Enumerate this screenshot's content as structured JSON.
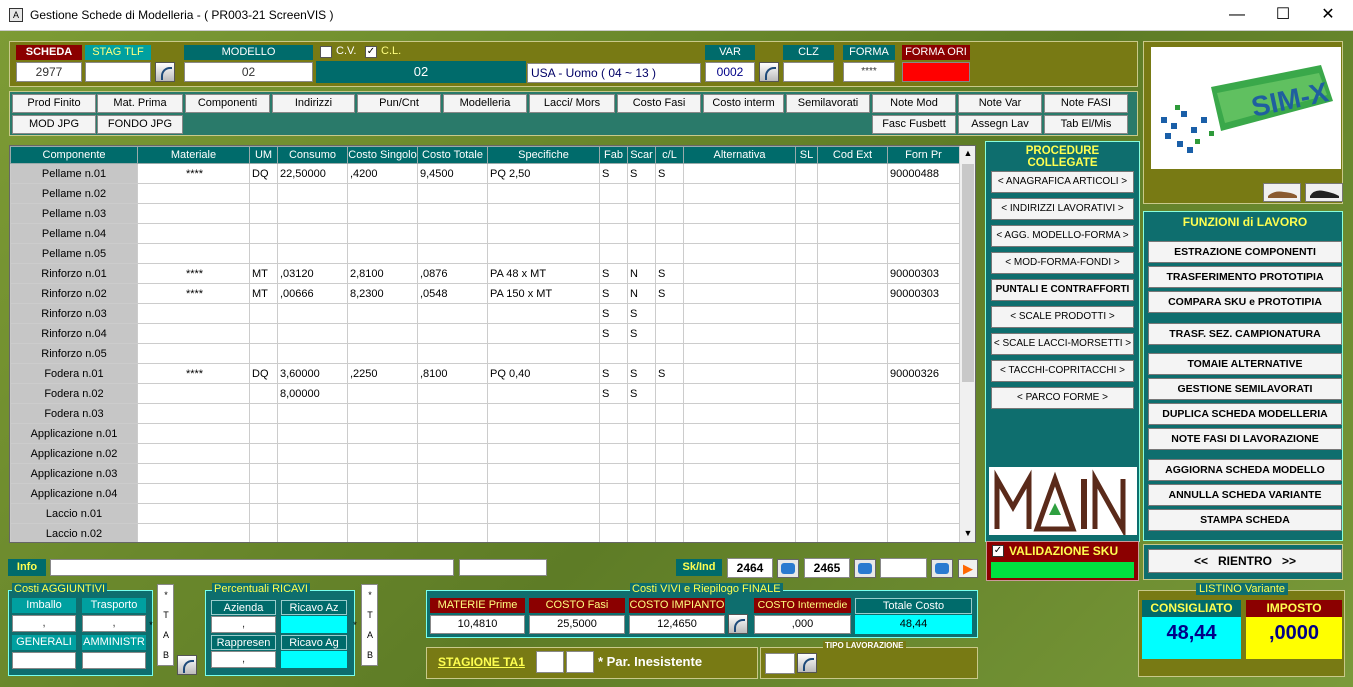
{
  "window": {
    "title": "Gestione Schede di Modelleria - ( PR003-21 ScreenVIS )",
    "app_icon": "A"
  },
  "header": {
    "scheda_label": "SCHEDA",
    "scheda_value": "2977",
    "stag_label": "STAG TLF",
    "stag_value": "",
    "modello_label": "MODELLO",
    "modello_value": "02",
    "cv_label": "C.V.",
    "cl_label": "C.L.",
    "cv_checked": false,
    "cl_checked": true,
    "modello_display": "02",
    "forma_desc": "USA - Uomo ( 04 ~ 13 )",
    "var_label": "VAR",
    "var_value": "0002",
    "clz_label": "CLZ",
    "clz_value": "",
    "forma_label": "FORMA",
    "forma_value": "****",
    "forma_ori_label": "FORMA ORI",
    "forma_ori_value": ""
  },
  "tabs_row1": [
    "Prod Finito",
    "Mat. Prima",
    "Componenti",
    "Indirizzi",
    "Pun/Cnt",
    "Modelleria",
    "Lacci/ Mors",
    "Costo Fasi",
    "Costo interm",
    "Semilavorati",
    "Note Mod",
    "Note Var",
    "Note FASI"
  ],
  "tabs_row2_left": [
    "MOD JPG",
    "FONDO JPG"
  ],
  "tabs_row2_right": [
    "Fasc Fusbett",
    "Assegn Lav",
    "Tab El/Mis"
  ],
  "grid": {
    "columns": [
      "Componente",
      "Materiale",
      "UM",
      "Consumo",
      "Costo Singolo",
      "Costo Totale",
      "Specifiche",
      "Fab",
      "Scar",
      "c/L",
      "Alternativa",
      "SL",
      "Cod Ext",
      "Forn Pr"
    ],
    "rows": [
      [
        "Pellame n.01",
        "****",
        "DQ",
        "22,50000",
        ",4200",
        "9,4500",
        "PQ 2,50",
        "S",
        "S",
        "S",
        "",
        "",
        "",
        "90000488"
      ],
      [
        "Pellame n.02",
        "",
        "",
        "",
        "",
        "",
        "",
        "",
        "",
        "",
        "",
        "",
        "",
        ""
      ],
      [
        "Pellame n.03",
        "",
        "",
        "",
        "",
        "",
        "",
        "",
        "",
        "",
        "",
        "",
        "",
        ""
      ],
      [
        "Pellame n.04",
        "",
        "",
        "",
        "",
        "",
        "",
        "",
        "",
        "",
        "",
        "",
        "",
        ""
      ],
      [
        "Pellame n.05",
        "",
        "",
        "",
        "",
        "",
        "",
        "",
        "",
        "",
        "",
        "",
        "",
        ""
      ],
      [
        "Rinforzo n.01",
        "****",
        "MT",
        ",03120",
        "2,8100",
        ",0876",
        "PA 48 x MT",
        "S",
        "N",
        "S",
        "",
        "",
        "",
        "90000303"
      ],
      [
        "Rinforzo n.02",
        "****",
        "MT",
        ",00666",
        "8,2300",
        ",0548",
        "PA 150 x MT",
        "S",
        "N",
        "S",
        "",
        "",
        "",
        "90000303"
      ],
      [
        "Rinforzo n.03",
        "",
        "",
        "",
        "",
        "",
        "",
        "S",
        "S",
        "",
        "",
        "",
        "",
        ""
      ],
      [
        "Rinforzo n.04",
        "",
        "",
        "",
        "",
        "",
        "",
        "S",
        "S",
        "",
        "",
        "",
        "",
        ""
      ],
      [
        "Rinforzo n.05",
        "",
        "",
        "",
        "",
        "",
        "",
        "",
        "",
        "",
        "",
        "",
        "",
        ""
      ],
      [
        "Fodera n.01",
        "****",
        "DQ",
        "3,60000",
        ",2250",
        ",8100",
        "PQ 0,40",
        "S",
        "S",
        "S",
        "",
        "",
        "",
        "90000326"
      ],
      [
        "Fodera n.02",
        "",
        "",
        "8,00000",
        "",
        "",
        "",
        "S",
        "S",
        "",
        "",
        "",
        "",
        ""
      ],
      [
        "Fodera n.03",
        "",
        "",
        "",
        "",
        "",
        "",
        "",
        "",
        "",
        "",
        "",
        "",
        ""
      ],
      [
        "Applicazione n.01",
        "",
        "",
        "",
        "",
        "",
        "",
        "",
        "",
        "",
        "",
        "",
        "",
        ""
      ],
      [
        "Applicazione n.02",
        "",
        "",
        "",
        "",
        "",
        "",
        "",
        "",
        "",
        "",
        "",
        "",
        ""
      ],
      [
        "Applicazione n.03",
        "",
        "",
        "",
        "",
        "",
        "",
        "",
        "",
        "",
        "",
        "",
        "",
        ""
      ],
      [
        "Applicazione n.04",
        "",
        "",
        "",
        "",
        "",
        "",
        "",
        "",
        "",
        "",
        "",
        "",
        ""
      ],
      [
        "Laccio n.01",
        "",
        "",
        "",
        "",
        "",
        "",
        "",
        "",
        "",
        "",
        "",
        "",
        ""
      ],
      [
        "Laccio n.02",
        "",
        "",
        "",
        "",
        "",
        "",
        "",
        "",
        "",
        "",
        "",
        "",
        ""
      ]
    ]
  },
  "procedure": {
    "title": "PROCEDURE COLLEGATE",
    "items": [
      "< ANAGRAFICA ARTICOLI >",
      "< INDIRIZZI LAVORATIVI >",
      "< AGG. MODELLO-FORMA >",
      "< MOD-FORMA-FONDI >",
      "PUNTALI E CONTRAFFORTI",
      "< SCALE PRODOTTI >",
      "< SCALE LACCI-MORSETTI >",
      "< TACCHI-COPRITACCHI >",
      "< PARCO FORME >"
    ]
  },
  "logo": {
    "brand": "SIM-X",
    "main_logo": "MAIN"
  },
  "funzioni": {
    "title": "FUNZIONI di LAVORO",
    "group1": [
      "ESTRAZIONE COMPONENTI",
      "TRASFERIMENTO PROTOTIPIA",
      "COMPARA SKU e PROTOTIPIA"
    ],
    "group2": [
      "TRASF. SEZ. CAMPIONATURA"
    ],
    "group3": [
      "TOMAIE ALTERNATIVE",
      "GESTIONE SEMILAVORATI",
      "DUPLICA SCHEDA MODELLERIA",
      "NOTE FASI DI LAVORAZIONE"
    ],
    "group4": [
      "AGGIORNA SCHEDA MODELLO",
      "ANNULLA SCHEDA VARIANTE",
      "STAMPA SCHEDA"
    ],
    "rientro": "<<   RIENTRO   >>"
  },
  "validazione": {
    "label": "VALIDAZIONE SKU",
    "checked": true
  },
  "info": {
    "label": "Info",
    "value": ""
  },
  "skind": {
    "label": "Sk/Ind",
    "a": "2464",
    "b": "2465",
    "c": ""
  },
  "costi_aggiuntivi": {
    "title": "Costi AGGIUNTIVI",
    "imballo": "Imballo",
    "trasporto": "Trasporto",
    "imballo_value": ",",
    "trasporto_value": ",",
    "generali": "GENERALI",
    "amministr": "AMMINISTR",
    "tab": "* T A B *"
  },
  "percentuali": {
    "title": "Percentuali RICAVI",
    "azienda": "Azienda",
    "azienda_value": ",",
    "ricavo_az": "Ricavo Az",
    "rappresen": "Rappresen",
    "rappresen_value": ",",
    "ricavo_ag": "Ricavo Ag",
    "tab": "* T A B *"
  },
  "costi_vivi": {
    "title": "Costi VIVI e Riepilogo FINALE",
    "materie_label": "MATERIE Prime",
    "materie_value": "10,4810",
    "fasi_label": "COSTO Fasi",
    "fasi_value": "25,5000",
    "impianto_label": "COSTO IMPIANTO",
    "impianto_value": "12,4650",
    "intermedie_label": "COSTO Intermedie",
    "intermedie_value": ",000",
    "totale_label": "Totale Costo",
    "totale_value": "48,44"
  },
  "stagione": {
    "label": "STAGIONE TA1",
    "note": "* Par. Inesistente"
  },
  "tipo_lavorazione": {
    "label": "TIPO LAVORAZIONE"
  },
  "listino": {
    "title": "LISTINO Variante",
    "consigliato_label": "CONSIGLIATO",
    "consigliato_value": "48,44",
    "imposto_label": "IMPOSTO",
    "imposto_value": ",0000"
  },
  "colors": {
    "teal": "#006b6b",
    "darkred": "#8b0000",
    "olive": "#787a14",
    "cyan": "#00ffff",
    "yellow": "#ffff00",
    "red": "#ff0000",
    "green": "#00e040"
  }
}
